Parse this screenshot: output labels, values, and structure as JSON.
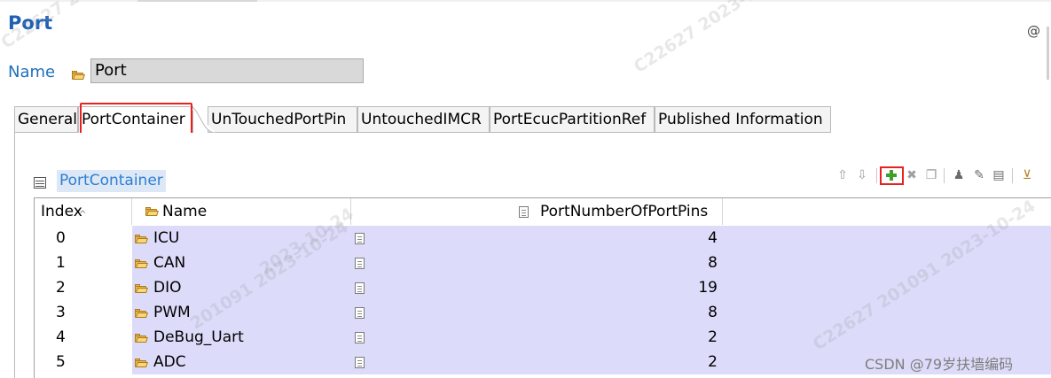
{
  "editor": {
    "title": "Port",
    "at_symbol": "@"
  },
  "name_field": {
    "label": "Name",
    "value": "Port"
  },
  "tabs": [
    {
      "label": "General"
    },
    {
      "label": "PortContainer",
      "selected": true
    },
    {
      "label": "UnTouchedPortPin"
    },
    {
      "label": "UntouchedIMCR"
    },
    {
      "label": "PortEcucPartitionRef"
    },
    {
      "label": "Published Information"
    }
  ],
  "section": {
    "title": "PortContainer"
  },
  "toolbar": {
    "icons": [
      "arrow-up-icon",
      "arrow-down-icon",
      "add-icon",
      "delete-icon",
      "copy-icon",
      "user-icon",
      "edit-icon",
      "edit-table-icon",
      "import-icon"
    ]
  },
  "table": {
    "columns": [
      {
        "label": "Index"
      },
      {
        "label": "Name"
      },
      {
        "label": "PortNumberOfPortPins"
      }
    ],
    "rows": [
      {
        "index": "0",
        "name": "ICU",
        "pins": "4"
      },
      {
        "index": "1",
        "name": "CAN",
        "pins": "8"
      },
      {
        "index": "2",
        "name": "DIO",
        "pins": "19"
      },
      {
        "index": "3",
        "name": "PWM",
        "pins": "8"
      },
      {
        "index": "4",
        "name": "DeBug_Uart",
        "pins": "2"
      },
      {
        "index": "5",
        "name": "ADC",
        "pins": "2"
      }
    ]
  },
  "watermarks": {
    "a": "C22627  2023-10-24",
    "b": "C22627  201091",
    "c": "2023-10-24",
    "d": "201091  2023-10-24",
    "e": "C22627  201091  2023-10-24"
  },
  "csdn_mark": "CSDN @79岁扶墙编码",
  "colors": {
    "accent_blue": "#1f5fb4",
    "row_highlight": "#dcdcfa",
    "red_annotation": "#e8211e",
    "add_green": "#3f9f2c"
  }
}
